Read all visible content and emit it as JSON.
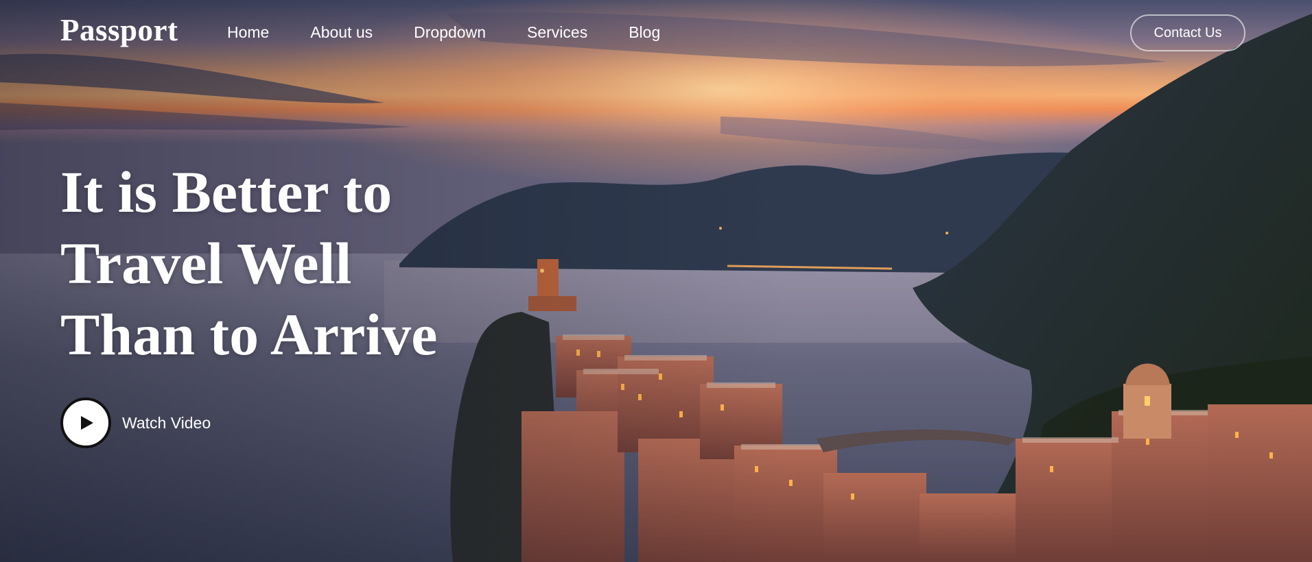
{
  "brand": {
    "logo": "Passport"
  },
  "nav": {
    "items": [
      {
        "label": "Home"
      },
      {
        "label": "About us"
      },
      {
        "label": "Dropdown"
      },
      {
        "label": "Services"
      },
      {
        "label": "Blog"
      }
    ],
    "contact_label": "Contact Us"
  },
  "hero": {
    "headline_lines": [
      "It is Better to",
      "Travel Well",
      "Than to Arrive"
    ],
    "watch_label": "Watch Video",
    "play_icon": "play-icon"
  },
  "colors": {
    "text": "#ffffff",
    "play_button_bg": "#ffffff",
    "play_button_border": "#111111",
    "contact_border": "rgba(255,255,255,0.6)"
  }
}
